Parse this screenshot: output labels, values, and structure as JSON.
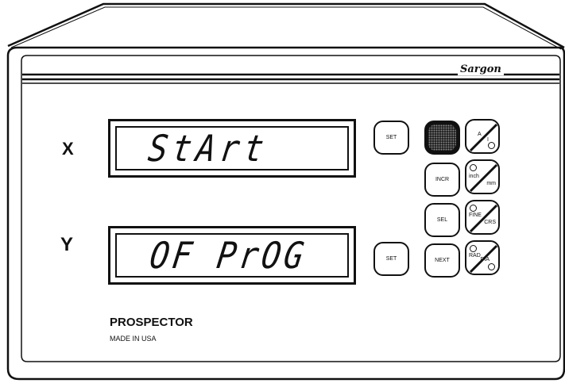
{
  "brand": {
    "logo": "Sargon"
  },
  "axes": [
    {
      "label": "X"
    },
    {
      "label": "Y"
    }
  ],
  "displays": {
    "x_text": "StArt",
    "y_text": "OF PrOG"
  },
  "keys": {
    "set_x": "SET",
    "set_y": "SET",
    "top_dark": "",
    "incr": "INCR",
    "sel": "SEL",
    "next": "NEXT"
  },
  "toggles": [
    {
      "top": "A",
      "bottom": "I"
    },
    {
      "top": "inch",
      "bottom": "mm"
    },
    {
      "top": "FINE",
      "bottom": "CRS"
    },
    {
      "top": "RAD",
      "bottom": "DIA"
    }
  ],
  "footer": {
    "model": "PROSPECTOR",
    "origin": "MADE IN USA"
  }
}
